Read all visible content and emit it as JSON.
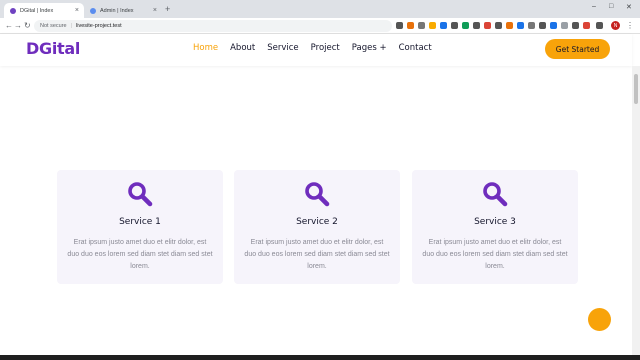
{
  "browser": {
    "tabs": [
      {
        "label": "DGital | Index"
      },
      {
        "label": "Admin | Index"
      }
    ],
    "new_tab": "+",
    "window_controls": {
      "minimize": "–",
      "maximize": "□",
      "close": "✕"
    },
    "nav": {
      "back": "←",
      "forward": "→",
      "reload": "↻"
    },
    "omnibox": {
      "security": "Not secure",
      "separator": "|",
      "url": "livesite-project.test"
    },
    "profile_initial": "N",
    "menu": "⋮"
  },
  "site": {
    "logo": "DGital",
    "nav": [
      {
        "label": "Home",
        "active": true
      },
      {
        "label": "About"
      },
      {
        "label": "Service"
      },
      {
        "label": "Project"
      },
      {
        "label": "Pages +"
      },
      {
        "label": "Contact"
      }
    ],
    "cta": "Get Started",
    "colors": {
      "brand": "#6f2dbd",
      "accent": "#f8a30a",
      "card_bg": "#f6f4fb"
    }
  },
  "services": [
    {
      "icon": "search-icon",
      "title": "Service 1",
      "desc": "Erat ipsum justo amet duo et elitr dolor, est duo duo eos lorem sed diam stet diam sed stet lorem."
    },
    {
      "icon": "search-icon",
      "title": "Service 2",
      "desc": "Erat ipsum justo amet duo et elitr dolor, est duo duo eos lorem sed diam stet diam sed stet lorem."
    },
    {
      "icon": "search-icon",
      "title": "Service 3",
      "desc": "Erat ipsum justo amet duo et elitr dolor, est duo duo eos lorem sed diam stet diam sed stet lorem."
    }
  ]
}
